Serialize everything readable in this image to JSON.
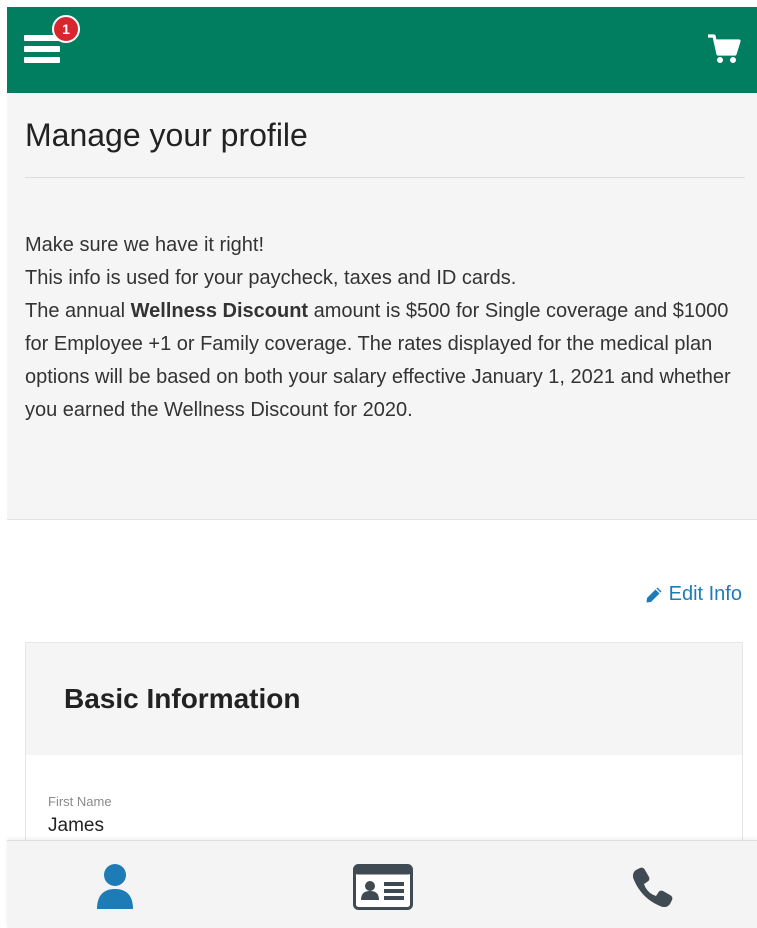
{
  "header": {
    "menu_badge_count": "1",
    "colors": {
      "brand": "#007e5f",
      "badge": "#d8262f"
    },
    "icons": [
      "hamburger-menu-icon",
      "cart-icon"
    ]
  },
  "intro": {
    "title": "Manage your profile",
    "line1": "Make sure we have it right!",
    "line2": "This info is used for your paycheck, taxes and ID cards.",
    "para_prefix": "The annual ",
    "para_bold": "Wellness Discount",
    "para_suffix": " amount is $500 for Single coverage and $1000 for Employee +1 or Family coverage.  The rates displayed for the medical plan options will be based on both your salary effective January 1, 2021 and whether you earned the Wellness Discount for 2020."
  },
  "edit": {
    "label": "Edit Info",
    "color": "#1d7cb6",
    "icon": "pencil-icon"
  },
  "basic_info": {
    "title": "Basic Information",
    "fields": [
      {
        "label": "First Name",
        "value": "James"
      }
    ]
  },
  "bottom_nav": {
    "active_color": "#1d7cb6",
    "inactive_color": "#3f4a52",
    "items": [
      {
        "icon": "person-icon",
        "active": true
      },
      {
        "icon": "id-card-icon",
        "active": false
      },
      {
        "icon": "phone-icon",
        "active": false
      }
    ]
  }
}
